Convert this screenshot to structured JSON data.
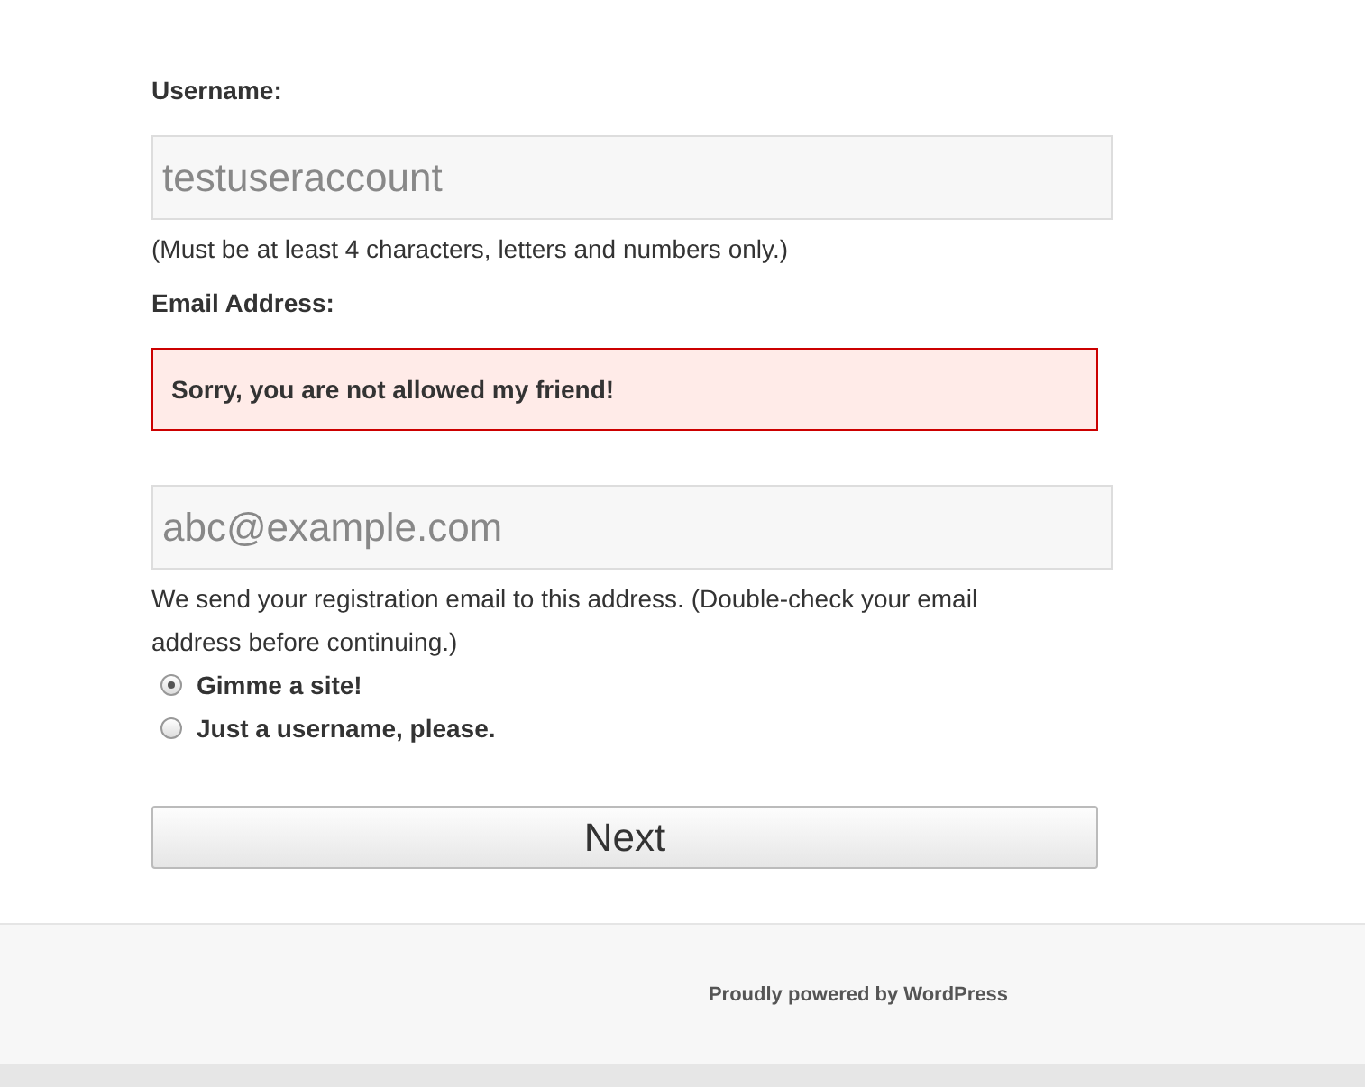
{
  "username": {
    "label": "Username:",
    "value": "testuseraccount",
    "hint": "(Must be at least 4 characters, letters and numbers only.)"
  },
  "email": {
    "label": "Email Address:",
    "error": "Sorry, you are not allowed my friend!",
    "placeholder": "abc@example.com",
    "hint": "We send your registration email to this address. (Double-check your email address before continuing.)"
  },
  "options": [
    {
      "label": "Gimme a site!",
      "selected": true
    },
    {
      "label": "Just a username, please.",
      "selected": false
    }
  ],
  "next_button": "Next",
  "footer": "Proudly powered by WordPress"
}
